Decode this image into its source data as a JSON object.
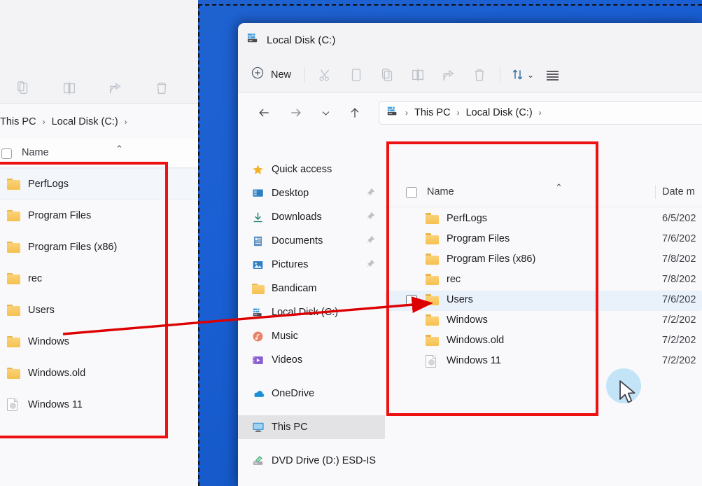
{
  "desktop": {
    "bg_color": "#1a5fd4"
  },
  "annotations": {
    "box_color": "#ee1111",
    "arrow_color": "#dd0000",
    "arrow_target_label": "Windows",
    "click_halo_color": "#b9e0f5"
  },
  "background_window": {
    "toolbar_icons": [
      "paste-icon",
      "rename-icon",
      "share-icon",
      "delete-icon"
    ],
    "breadcrumb": [
      "This PC",
      "Local Disk (C:)"
    ],
    "breadcrumb_separator": "›",
    "column_header": {
      "name": "Name",
      "sort_arrow": "⌃"
    },
    "rows": [
      {
        "name": "PerfLogs",
        "icon": "folder-icon",
        "highlight": true
      },
      {
        "name": "Program Files",
        "icon": "folder-icon",
        "highlight": false
      },
      {
        "name": "Program Files (x86)",
        "icon": "folder-icon",
        "highlight": false
      },
      {
        "name": "rec",
        "icon": "folder-icon",
        "highlight": false
      },
      {
        "name": "Users",
        "icon": "folder-icon",
        "highlight": false
      },
      {
        "name": "Windows",
        "icon": "folder-icon",
        "highlight": false
      },
      {
        "name": "Windows.old",
        "icon": "folder-icon",
        "highlight": false
      },
      {
        "name": "Windows 11",
        "icon": "file-icon",
        "highlight": false
      }
    ]
  },
  "window": {
    "title": "Local Disk (C:)",
    "title_icon": "local-disk-icon",
    "toolbar": {
      "new_label": "New",
      "new_icon": "plus-circle-icon",
      "icons": [
        "cut-icon",
        "copy-icon",
        "paste-icon",
        "rename-icon",
        "share-icon",
        "delete-icon"
      ],
      "sort_icon": "sort-icon",
      "sort_chevron": "⌄",
      "view_icon": "view-list-icon"
    },
    "nav": {
      "back_icon": "arrow-left-icon",
      "forward_icon": "arrow-right-icon",
      "recent_icon": "chevron-down-icon",
      "up_icon": "arrow-up-icon",
      "breadcrumb_icon": "local-disk-icon",
      "breadcrumb": [
        "This PC",
        "Local Disk (C:)"
      ],
      "breadcrumb_separator": "›"
    },
    "sidebar": {
      "items": [
        {
          "label": "Quick access",
          "icon": "star-icon",
          "pinned": false,
          "selected": false,
          "gap_before": false
        },
        {
          "label": "Desktop",
          "icon": "desktop-icon",
          "pinned": true,
          "selected": false,
          "gap_before": false
        },
        {
          "label": "Downloads",
          "icon": "downloads-icon",
          "pinned": true,
          "selected": false,
          "gap_before": false
        },
        {
          "label": "Documents",
          "icon": "documents-icon",
          "pinned": true,
          "selected": false,
          "gap_before": false
        },
        {
          "label": "Pictures",
          "icon": "pictures-icon",
          "pinned": true,
          "selected": false,
          "gap_before": false
        },
        {
          "label": "Bandicam",
          "icon": "folder-icon",
          "pinned": false,
          "selected": false,
          "gap_before": false
        },
        {
          "label": "Local Disk (C:)",
          "icon": "local-disk-icon",
          "pinned": false,
          "selected": false,
          "gap_before": false
        },
        {
          "label": "Music",
          "icon": "music-icon",
          "pinned": false,
          "selected": false,
          "gap_before": false
        },
        {
          "label": "Videos",
          "icon": "videos-icon",
          "pinned": false,
          "selected": false,
          "gap_before": false
        },
        {
          "label": "OneDrive",
          "icon": "onedrive-icon",
          "pinned": false,
          "selected": false,
          "gap_before": true
        },
        {
          "label": "This PC",
          "icon": "this-pc-icon",
          "pinned": false,
          "selected": true,
          "gap_before": true
        },
        {
          "label": "DVD Drive (D:) ESD-IS",
          "icon": "dvd-drive-icon",
          "pinned": false,
          "selected": false,
          "gap_before": true
        }
      ]
    },
    "file_list": {
      "columns": {
        "name": "Name",
        "date_modified": "Date m",
        "sort_arrow": "⌃"
      },
      "rows": [
        {
          "name": "PerfLogs",
          "icon": "folder-icon",
          "date": "6/5/202",
          "hovered": false,
          "checkbox": false
        },
        {
          "name": "Program Files",
          "icon": "folder-icon",
          "date": "7/6/202",
          "hovered": false,
          "checkbox": false
        },
        {
          "name": "Program Files (x86)",
          "icon": "folder-icon",
          "date": "7/8/202",
          "hovered": false,
          "checkbox": false
        },
        {
          "name": "rec",
          "icon": "folder-icon",
          "date": "7/8/202",
          "hovered": false,
          "checkbox": false
        },
        {
          "name": "Users",
          "icon": "folder-icon",
          "date": "7/6/202",
          "hovered": true,
          "checkbox": true
        },
        {
          "name": "Windows",
          "icon": "folder-icon",
          "date": "7/2/202",
          "hovered": false,
          "checkbox": false
        },
        {
          "name": "Windows.old",
          "icon": "folder-icon",
          "date": "7/2/202",
          "hovered": false,
          "checkbox": false
        },
        {
          "name": "Windows 11",
          "icon": "file-icon",
          "date": "7/2/202",
          "hovered": false,
          "checkbox": false
        }
      ]
    }
  }
}
